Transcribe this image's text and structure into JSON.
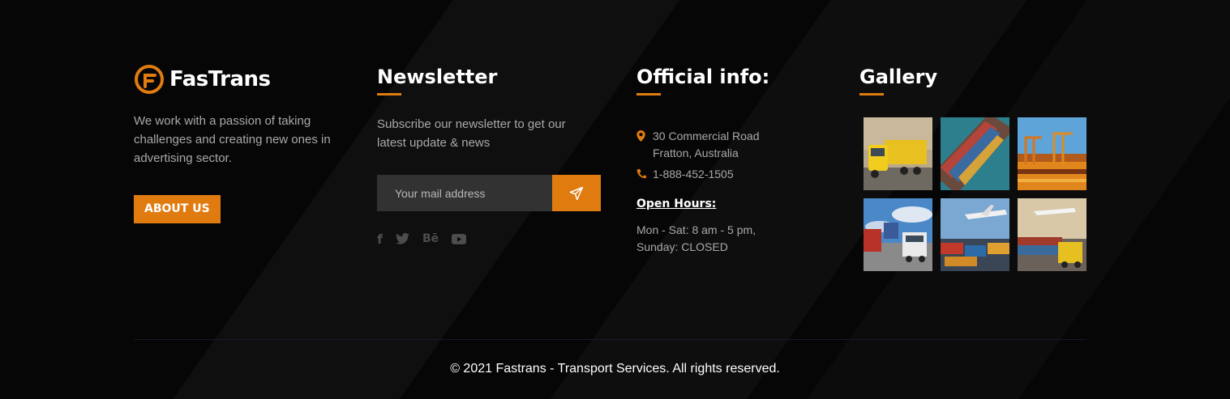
{
  "brand": {
    "name": "FasTrans",
    "accent": "#e07b10"
  },
  "about": {
    "text": "We work with a passion of taking challenges and creating new ones in advertising sector.",
    "button_label": "ABOUT US"
  },
  "newsletter": {
    "heading": "Newsletter",
    "text": "Subscribe our newsletter to get our latest update & news",
    "input_placeholder": "Your mail address",
    "send_icon": "paper-plane-icon",
    "social": [
      {
        "name": "facebook-icon",
        "glyph": "f"
      },
      {
        "name": "twitter-icon",
        "glyph": ""
      },
      {
        "name": "behance-icon",
        "glyph": "Bē"
      },
      {
        "name": "youtube-icon",
        "glyph": ""
      }
    ]
  },
  "official": {
    "heading": "Official info:",
    "address_line1": "30 Commercial Road",
    "address_line2": "Fratton, Australia",
    "phone": "1-888-452-1505",
    "open_hours_title": "Open Hours:",
    "hours_line1": "Mon - Sat: 8 am - 5 pm,",
    "hours_line2": "Sunday: CLOSED"
  },
  "gallery": {
    "heading": "Gallery",
    "images": [
      "yellow-truck-photo",
      "container-ship-aerial-photo",
      "port-cranes-sunset-photo",
      "forklift-containers-photo",
      "cargo-plane-loading-photo",
      "plane-over-ship-photo"
    ]
  },
  "footer": {
    "copyright": "© 2021 Fastrans - Transport Services. All rights reserved."
  }
}
